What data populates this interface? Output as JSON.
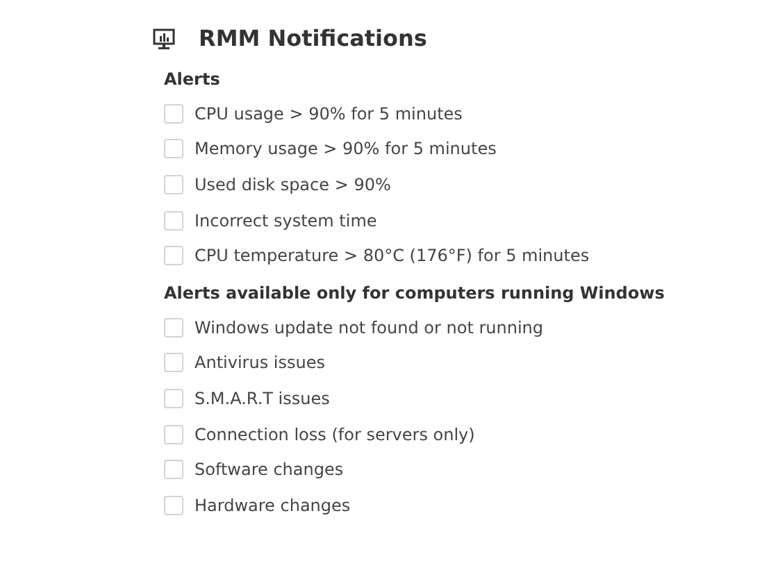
{
  "header": {
    "title": "RMM Notifications"
  },
  "sections": [
    {
      "heading": "Alerts",
      "items": [
        {
          "label": "CPU usage > 90% for 5 minutes",
          "checked": false
        },
        {
          "label": "Memory usage > 90% for 5 minutes",
          "checked": false
        },
        {
          "label": "Used disk space > 90%",
          "checked": false
        },
        {
          "label": "Incorrect system time",
          "checked": false
        },
        {
          "label": "CPU temperature > 80°C (176°F) for 5 minutes",
          "checked": false
        }
      ]
    },
    {
      "heading": "Alerts available only for computers running Windows",
      "items": [
        {
          "label": "Windows update not found or not running",
          "checked": false
        },
        {
          "label": "Antivirus issues",
          "checked": false
        },
        {
          "label": "S.M.A.R.T issues",
          "checked": false
        },
        {
          "label": "Connection loss (for servers only)",
          "checked": false
        },
        {
          "label": "Software changes",
          "checked": false
        },
        {
          "label": "Hardware changes",
          "checked": false
        }
      ]
    }
  ]
}
